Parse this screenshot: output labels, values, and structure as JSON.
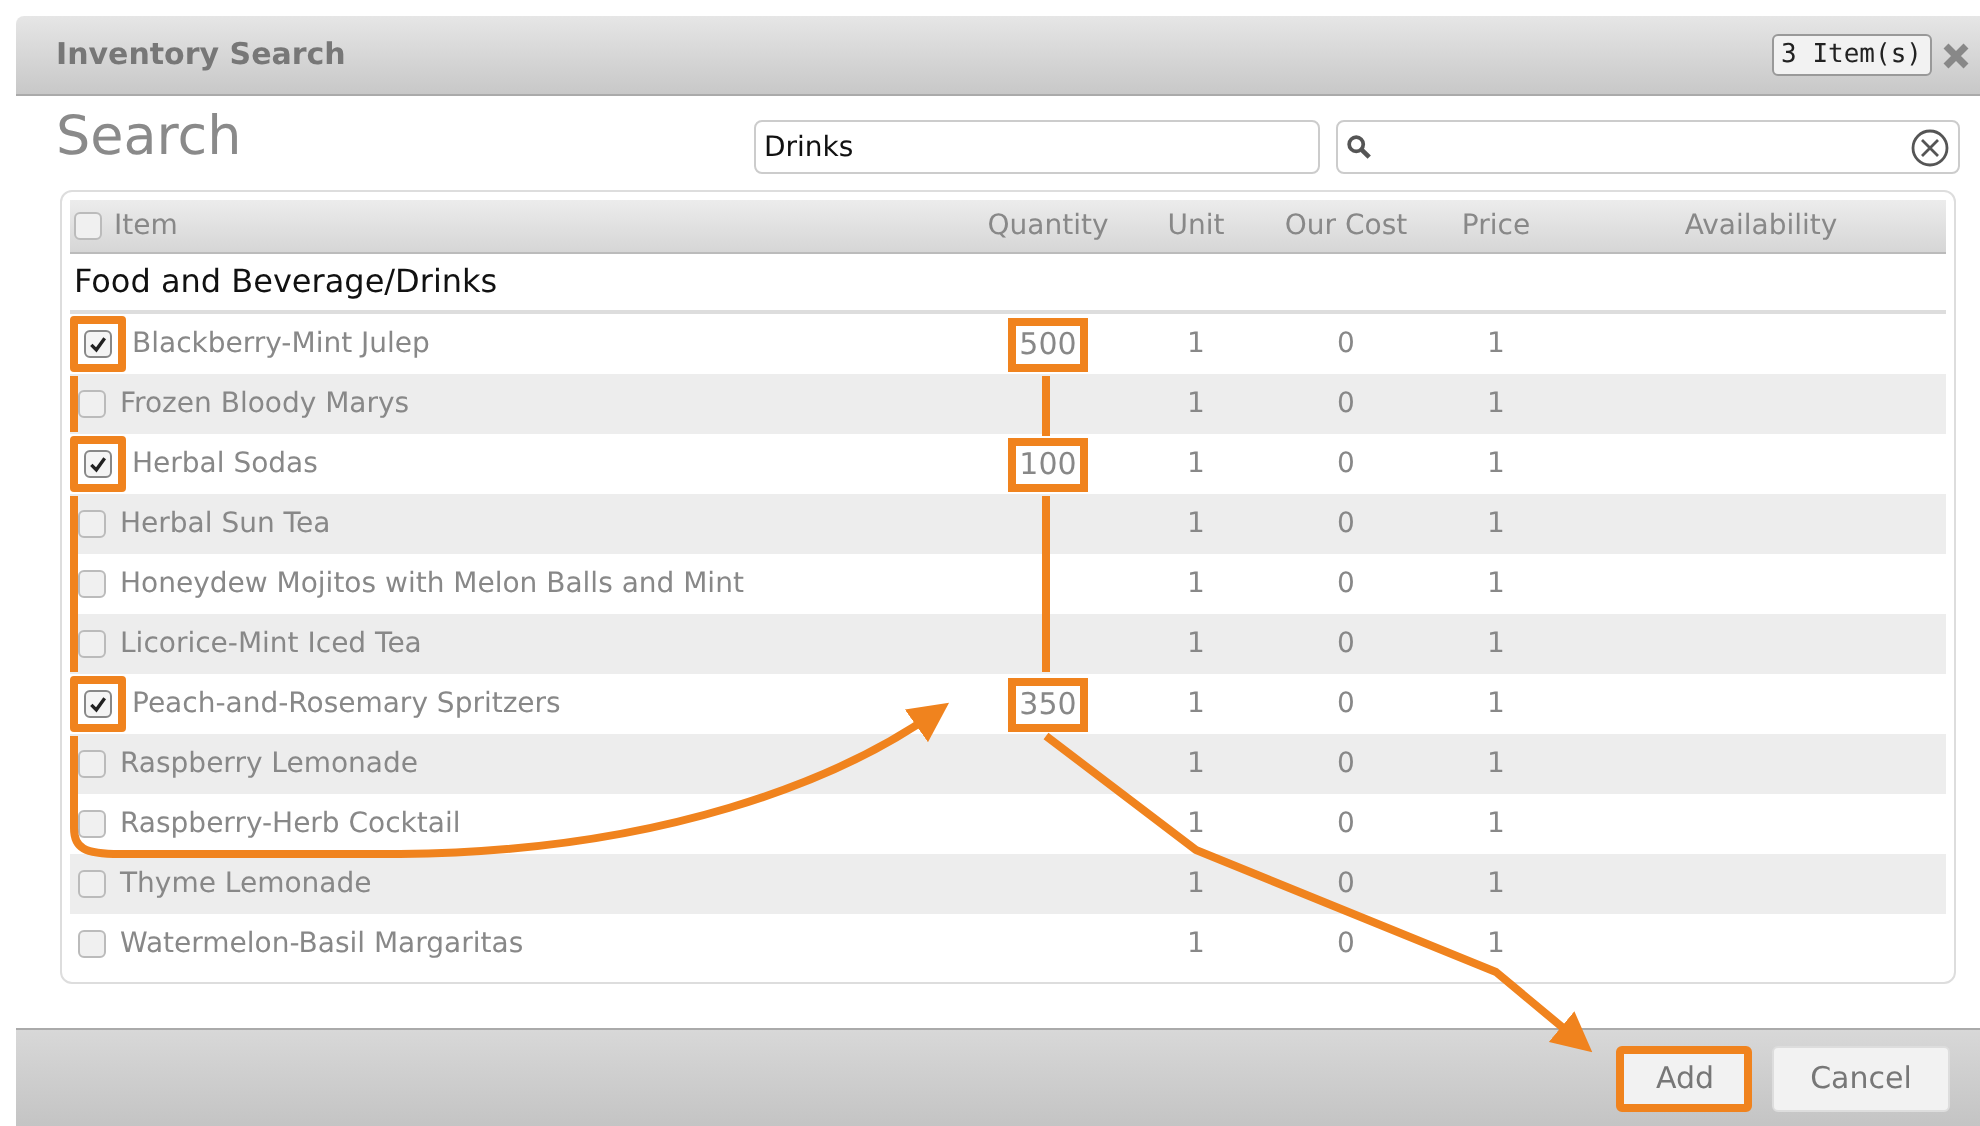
{
  "window": {
    "title": "Inventory Search",
    "badge": "3 Item(s)"
  },
  "heading": "Search",
  "category_field": {
    "value": "Drinks"
  },
  "table": {
    "select_all": {
      "checked": false
    },
    "columns": [
      "Item",
      "Quantity",
      "Unit",
      "Our Cost",
      "Price",
      "Availability"
    ],
    "group": "Food and Beverage/Drinks",
    "rows": [
      {
        "name": "Blackberry-Mint Julep",
        "checked": true,
        "quantity": "500",
        "unit": "1",
        "our_cost": "0",
        "price": "1"
      },
      {
        "name": "Frozen Bloody Marys",
        "checked": false,
        "unit": "1",
        "our_cost": "0",
        "price": "1"
      },
      {
        "name": "Herbal Sodas",
        "checked": true,
        "quantity": "100",
        "unit": "1",
        "our_cost": "0",
        "price": "1"
      },
      {
        "name": "Herbal Sun Tea",
        "checked": false,
        "unit": "1",
        "our_cost": "0",
        "price": "1"
      },
      {
        "name": "Honeydew Mojitos with Melon Balls and Mint",
        "checked": false,
        "unit": "1",
        "our_cost": "0",
        "price": "1"
      },
      {
        "name": "Licorice-Mint Iced Tea",
        "checked": false,
        "unit": "1",
        "our_cost": "0",
        "price": "1"
      },
      {
        "name": "Peach-and-Rosemary Spritzers",
        "checked": true,
        "quantity": "350",
        "unit": "1",
        "our_cost": "0",
        "price": "1"
      },
      {
        "name": "Raspberry Lemonade",
        "checked": false,
        "unit": "1",
        "our_cost": "0",
        "price": "1"
      },
      {
        "name": "Raspberry-Herb Cocktail",
        "checked": false,
        "unit": "1",
        "our_cost": "0",
        "price": "1"
      },
      {
        "name": "Thyme Lemonade",
        "checked": false,
        "unit": "1",
        "our_cost": "0",
        "price": "1"
      },
      {
        "name": "Watermelon-Basil Margaritas",
        "checked": false,
        "unit": "1",
        "our_cost": "0",
        "price": "1"
      }
    ]
  },
  "buttons": [
    {
      "label": "Add",
      "highlighted": true
    },
    {
      "label": "Cancel",
      "highlighted": false
    }
  ]
}
